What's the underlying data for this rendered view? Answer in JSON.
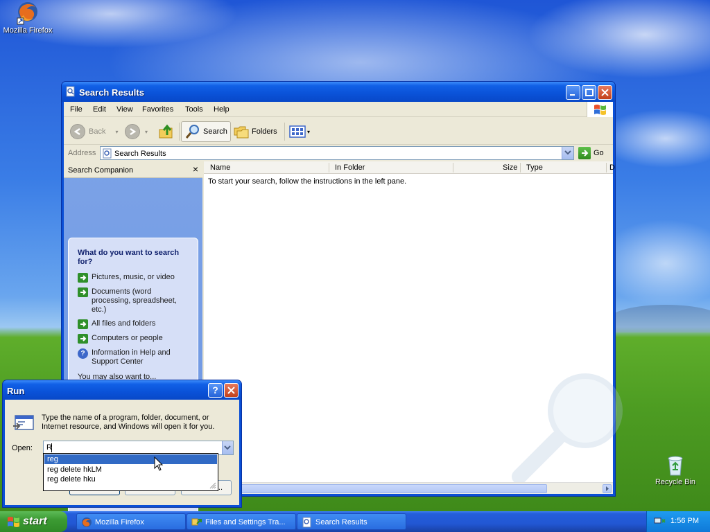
{
  "desktop": {
    "firefox_label": "Mozilla Firefox",
    "recycle_label": "Recycle Bin"
  },
  "explorer": {
    "title": "Search Results",
    "menu": [
      "File",
      "Edit",
      "View",
      "Favorites",
      "Tools",
      "Help"
    ],
    "toolbar": {
      "back": "Back",
      "search": "Search",
      "folders": "Folders"
    },
    "address_label": "Address",
    "address_value": "Search Results",
    "go_label": "Go",
    "left_pane": {
      "header": "Search Companion",
      "close": "×",
      "question": "What do you want to search for?",
      "items": [
        "Pictures, music, or video",
        "Documents (word processing, spreadsheet, etc.)",
        "All files and folders",
        "Computers or people",
        "Information in Help and Support Center"
      ],
      "also": "You may also want to..."
    },
    "columns": [
      "Name",
      "In Folder",
      "Size",
      "Type",
      "D"
    ],
    "hint": "To start your search, follow the instructions in the left pane."
  },
  "run": {
    "title": "Run",
    "help": "?",
    "description": "Type the name of a program, folder, document, or Internet resource, and Windows will open it for you.",
    "open_label": "Open:",
    "value": "R",
    "suggestions": [
      "reg",
      "reg delete hkLM",
      "reg delete hku"
    ],
    "ok_fragment": "..."
  },
  "taskbar": {
    "start_label": "start",
    "tasks": [
      "Mozilla Firefox",
      "Files and Settings Tra...",
      "Search Results"
    ],
    "clock": "1:56 PM"
  },
  "colors": {
    "xp_blue": "#0a52d8",
    "start_green": "#3c9b33",
    "selection": "#316ac5"
  }
}
